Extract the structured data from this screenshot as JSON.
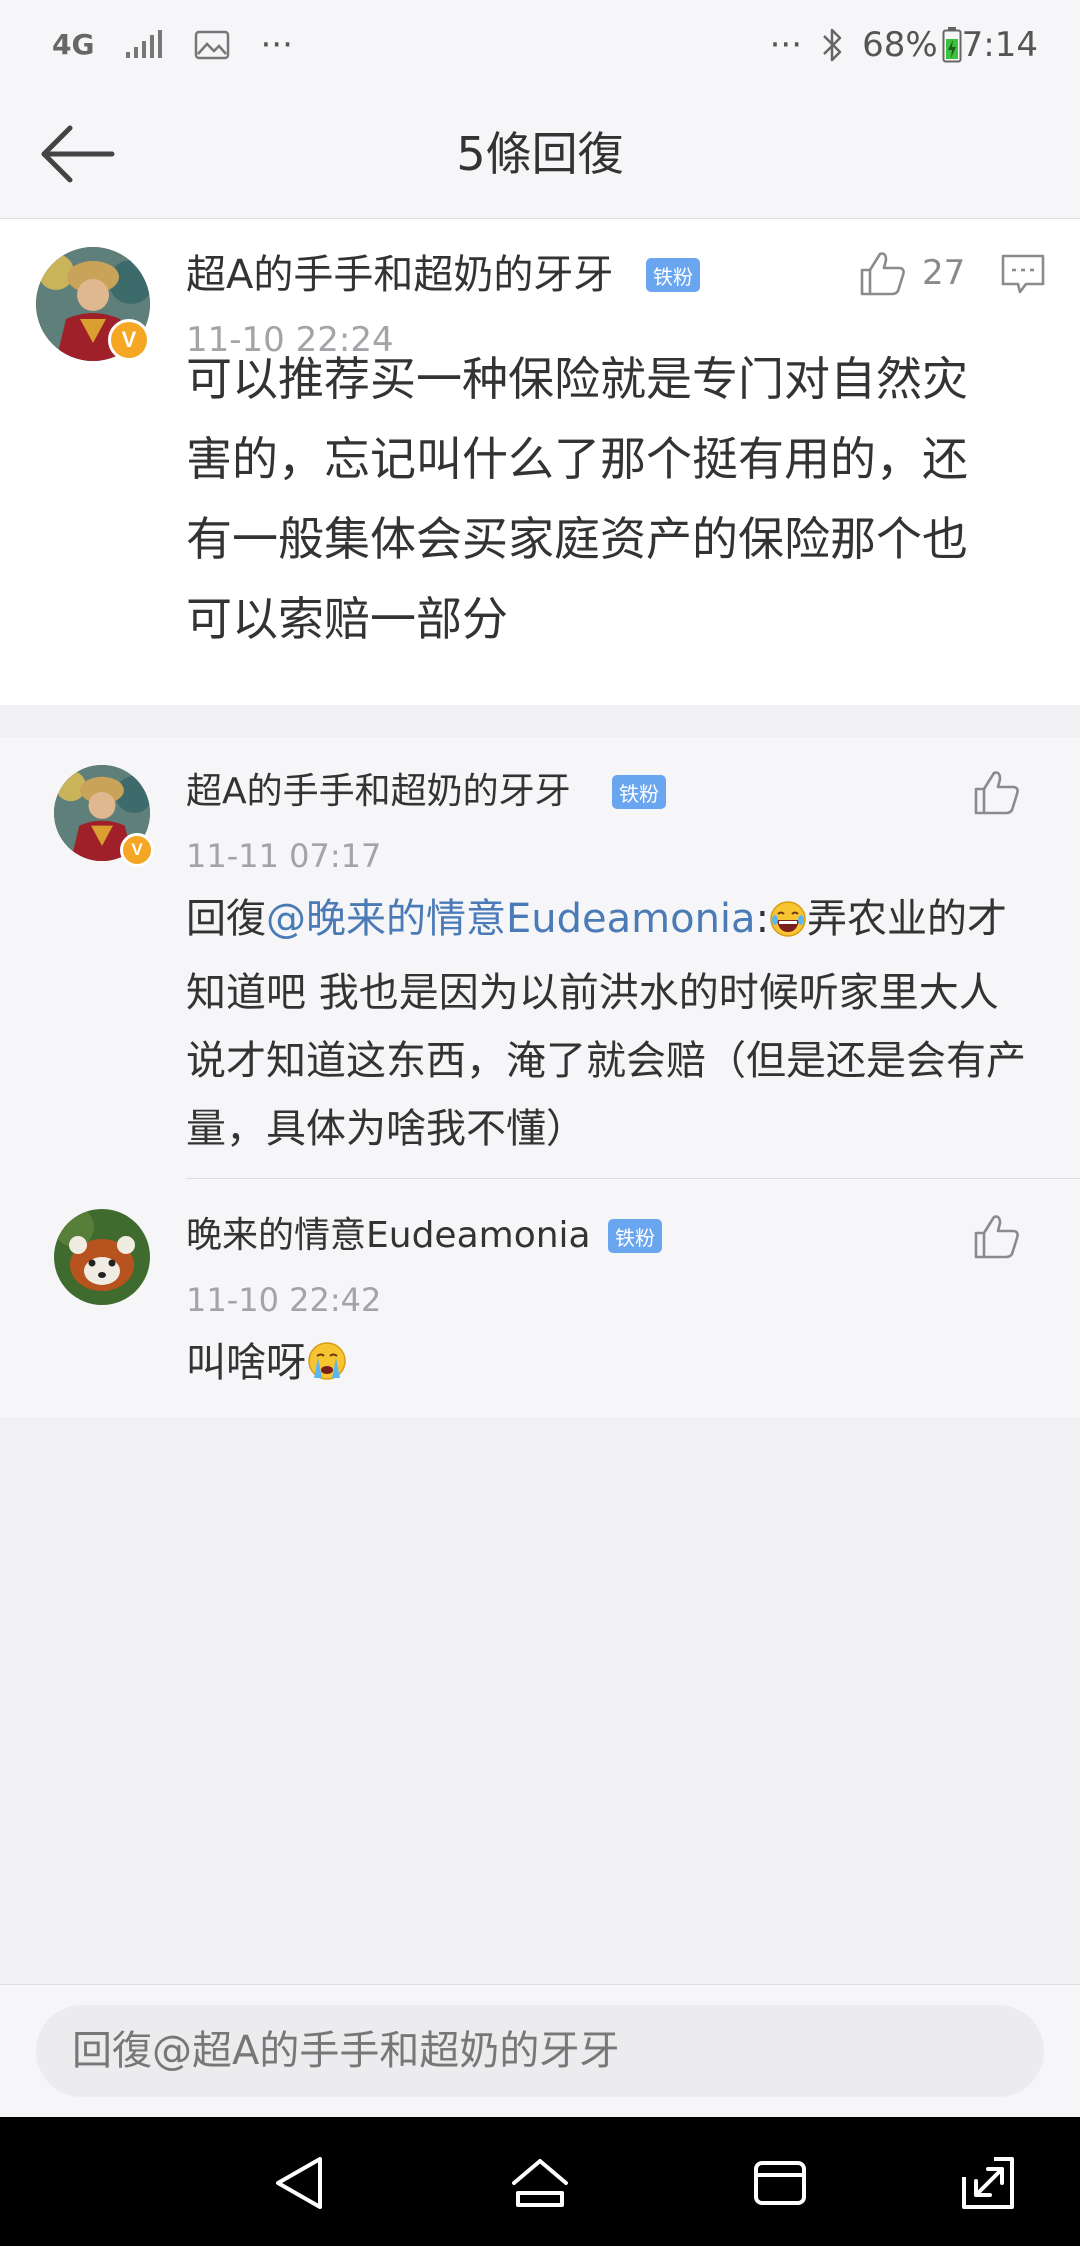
{
  "status_bar": {
    "network": "4G",
    "dots": "···",
    "battery_percent": "68%",
    "time": "7:14"
  },
  "header": {
    "title": "5條回復"
  },
  "main_comment": {
    "username": "超A的手手和超奶的牙牙",
    "badge": "铁粉",
    "timestamp": "11-10 22:24",
    "like_count": "27",
    "text": "可以推荐买一种保险就是专门对自然灾害的，忘记叫什么了那个挺有用的，还有一般集体会买家庭资产的保险那个也可以索赔一部分"
  },
  "replies": [
    {
      "username": "超A的手手和超奶的牙牙",
      "badge": "铁粉",
      "timestamp": "11-11 07:17",
      "reply_prefix": "回復",
      "mention": "@晚来的情意Eudeamonia",
      "colon": ":",
      "text": "弄农业的才知道吧  我也是因为以前洪水的时候听家里大人说才知道这东西，淹了就会赔（但是还是会有产量，具体为啥我不懂）"
    },
    {
      "username": "晚来的情意Eudeamonia",
      "badge": "铁粉",
      "timestamp": "11-10 22:42",
      "text": "叫啥呀"
    }
  ],
  "reply_bar": {
    "placeholder": "回復@超A的手手和超奶的牙牙"
  },
  "colors": {
    "accent_link": "#4a7bb7",
    "fan_badge": "#6aa6ef",
    "verified": "#f5a623",
    "battery_green": "#3cc13c"
  },
  "icons": {
    "back": "arrow-left-icon",
    "like": "thumbs-up-icon",
    "comment": "comment-icon",
    "nav_back": "triangle-back-icon",
    "nav_home": "home-icon",
    "nav_recent": "recent-apps-icon",
    "nav_expand": "expand-icon"
  }
}
